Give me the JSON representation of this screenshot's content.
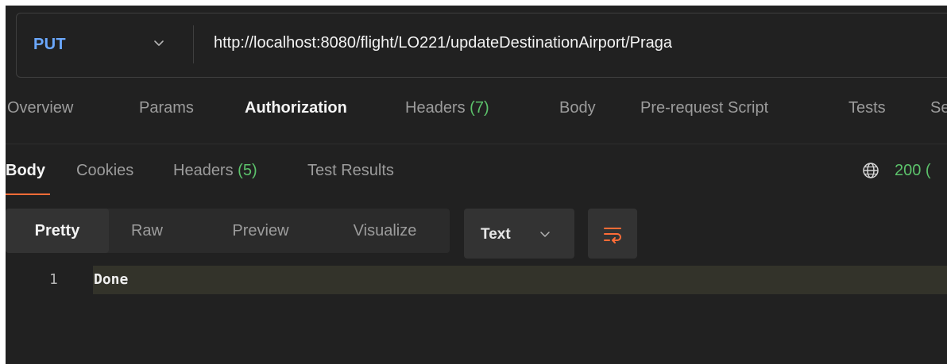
{
  "request": {
    "method": "PUT",
    "url": "http://localhost:8080/flight/LO221/updateDestinationAirport/Praga"
  },
  "request_tabs": {
    "overview": "Overview",
    "params": "Params",
    "authorization": "Authorization",
    "headers_label": "Headers",
    "headers_count": "(7)",
    "body": "Body",
    "pre_request_script": "Pre-request Script",
    "tests": "Tests",
    "settings_partial": "Se"
  },
  "response_tabs": {
    "body": "Body",
    "cookies": "Cookies",
    "headers_label": "Headers",
    "headers_count": "(5)",
    "test_results": "Test Results"
  },
  "response_status": {
    "code_partial": "200 ("
  },
  "format": {
    "pretty": "Pretty",
    "raw": "Raw",
    "preview": "Preview",
    "visualize": "Visualize",
    "type_selected": "Text"
  },
  "response_body": {
    "line_numbers": [
      "1"
    ],
    "lines": [
      "Done"
    ]
  },
  "colors": {
    "method": "#6ba8ff",
    "count_green": "#5cc26b",
    "active_underline": "#ff6c37",
    "background": "#212121"
  },
  "icons": {
    "method_dropdown": "chevron-down-icon",
    "globe": "globe-icon",
    "type_dropdown": "chevron-down-icon",
    "wrap": "wrap-lines-icon"
  }
}
